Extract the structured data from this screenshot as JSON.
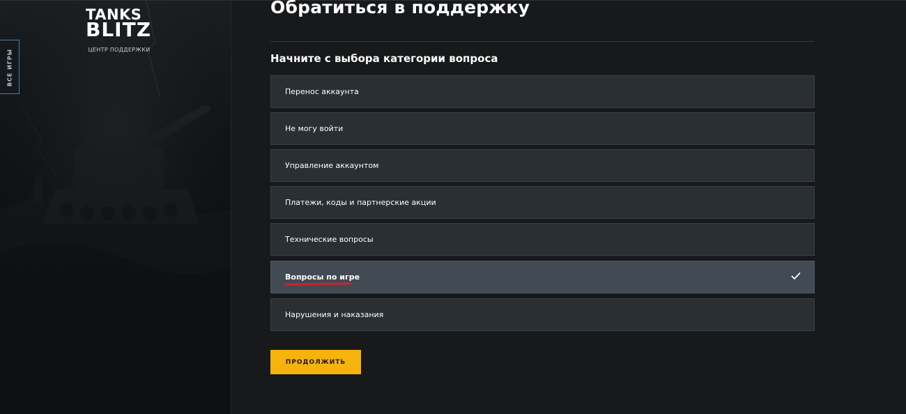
{
  "sidebar": {
    "logo": {
      "line1": "TANKS",
      "line2": "BLITZ",
      "subtitle": "ЦЕНТР ПОДДЕРЖКИ"
    },
    "all_games_tab": "ВСЕ ИГРЫ"
  },
  "main": {
    "title": "Обратиться в поддержку",
    "subtitle": "Начните с выбора категории вопроса",
    "categories": [
      {
        "label": "Перенос аккаунта",
        "selected": false
      },
      {
        "label": "Не могу войти",
        "selected": false
      },
      {
        "label": "Управление аккаунтом",
        "selected": false
      },
      {
        "label": "Платежи, коды и партнерские акции",
        "selected": false
      },
      {
        "label": "Технические вопросы",
        "selected": false
      },
      {
        "label": "Вопросы по игре",
        "selected": true
      },
      {
        "label": "Нарушения и наказания",
        "selected": false
      }
    ],
    "continue_label": "ПРОДОЛЖИТЬ"
  },
  "colors": {
    "accent_button": "#f5b30c",
    "item_bg": "#2a2f34",
    "item_selected_bg": "#424b54",
    "annotation_underline": "#d0212a",
    "tab_border": "#4d7ea8"
  },
  "icons": {
    "selected_marker": "check-icon"
  }
}
